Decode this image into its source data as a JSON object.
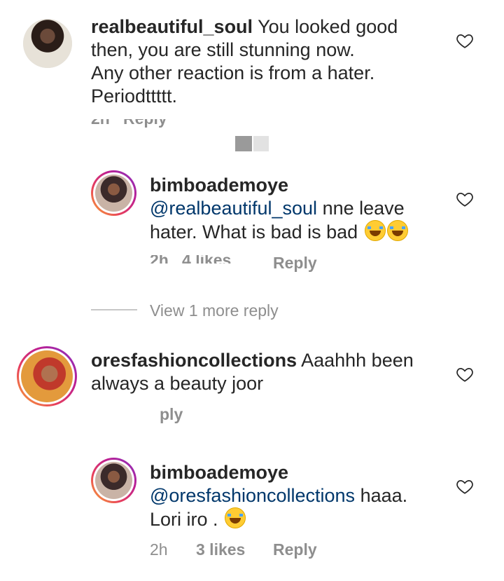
{
  "comments": [
    {
      "username": "realbeautiful_soul",
      "text_lines": [
        "You looked good",
        "then, you are still stunning now.",
        "Any other reaction is from a hater.",
        "Periodttttt."
      ]
    },
    {
      "username": "bimboademoye",
      "mention": "@realbeautiful_soul",
      "text_after_mention": " nne leave",
      "line2": "hater. What is bad is bad",
      "reply_label": "Reply"
    },
    {
      "username": "oresfashioncollections",
      "text_after_user": " Aaahhh been",
      "line2": "always a beauty joor",
      "partial_label": "ply"
    },
    {
      "username": "bimboademoye",
      "mention": "@oresfashioncollections",
      "text_after_mention": " haaa.",
      "line2": "Lori iro .",
      "time": "2h",
      "likes": "3 likes",
      "reply_label": "Reply"
    }
  ],
  "view_more": "View 1 more reply",
  "icons": {
    "heart": "heart-outline-icon",
    "emoji": "face-with-tears-of-joy-icon"
  },
  "colors": {
    "text": "#262626",
    "meta": "#8e8e8e",
    "mention": "#00376b"
  }
}
